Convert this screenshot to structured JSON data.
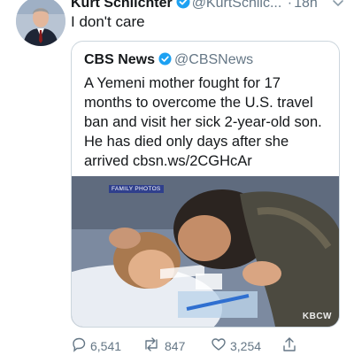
{
  "tweet": {
    "author_name": "Kurt Schlichter",
    "handle": "@KurtSchlic...",
    "separator": "·",
    "time": "18h",
    "text": "I don't care"
  },
  "quoted": {
    "author_name": "CBS News",
    "handle": "@CBSNews",
    "lines": [
      "A Yemeni mother fought for 17",
      "months to overcome the U.S. travel",
      "ban and visit her sick 2-year-old son.",
      "He has died only days after she",
      "arrived cbsn.ws/2CGHcAr"
    ],
    "image_tag": "FAMILY PHOTOS",
    "watermark": "KBCW"
  },
  "actions": {
    "replies": "6,541",
    "retweets": "847",
    "likes": "3,254"
  },
  "colors": {
    "verified": "#1da1f2",
    "secondary_text": "#657786",
    "border": "#ccd6dd"
  },
  "icons": [
    "avatar",
    "verified-badge-icon",
    "chevron-down-icon",
    "reply-icon",
    "retweet-icon",
    "like-icon",
    "share-icon"
  ]
}
